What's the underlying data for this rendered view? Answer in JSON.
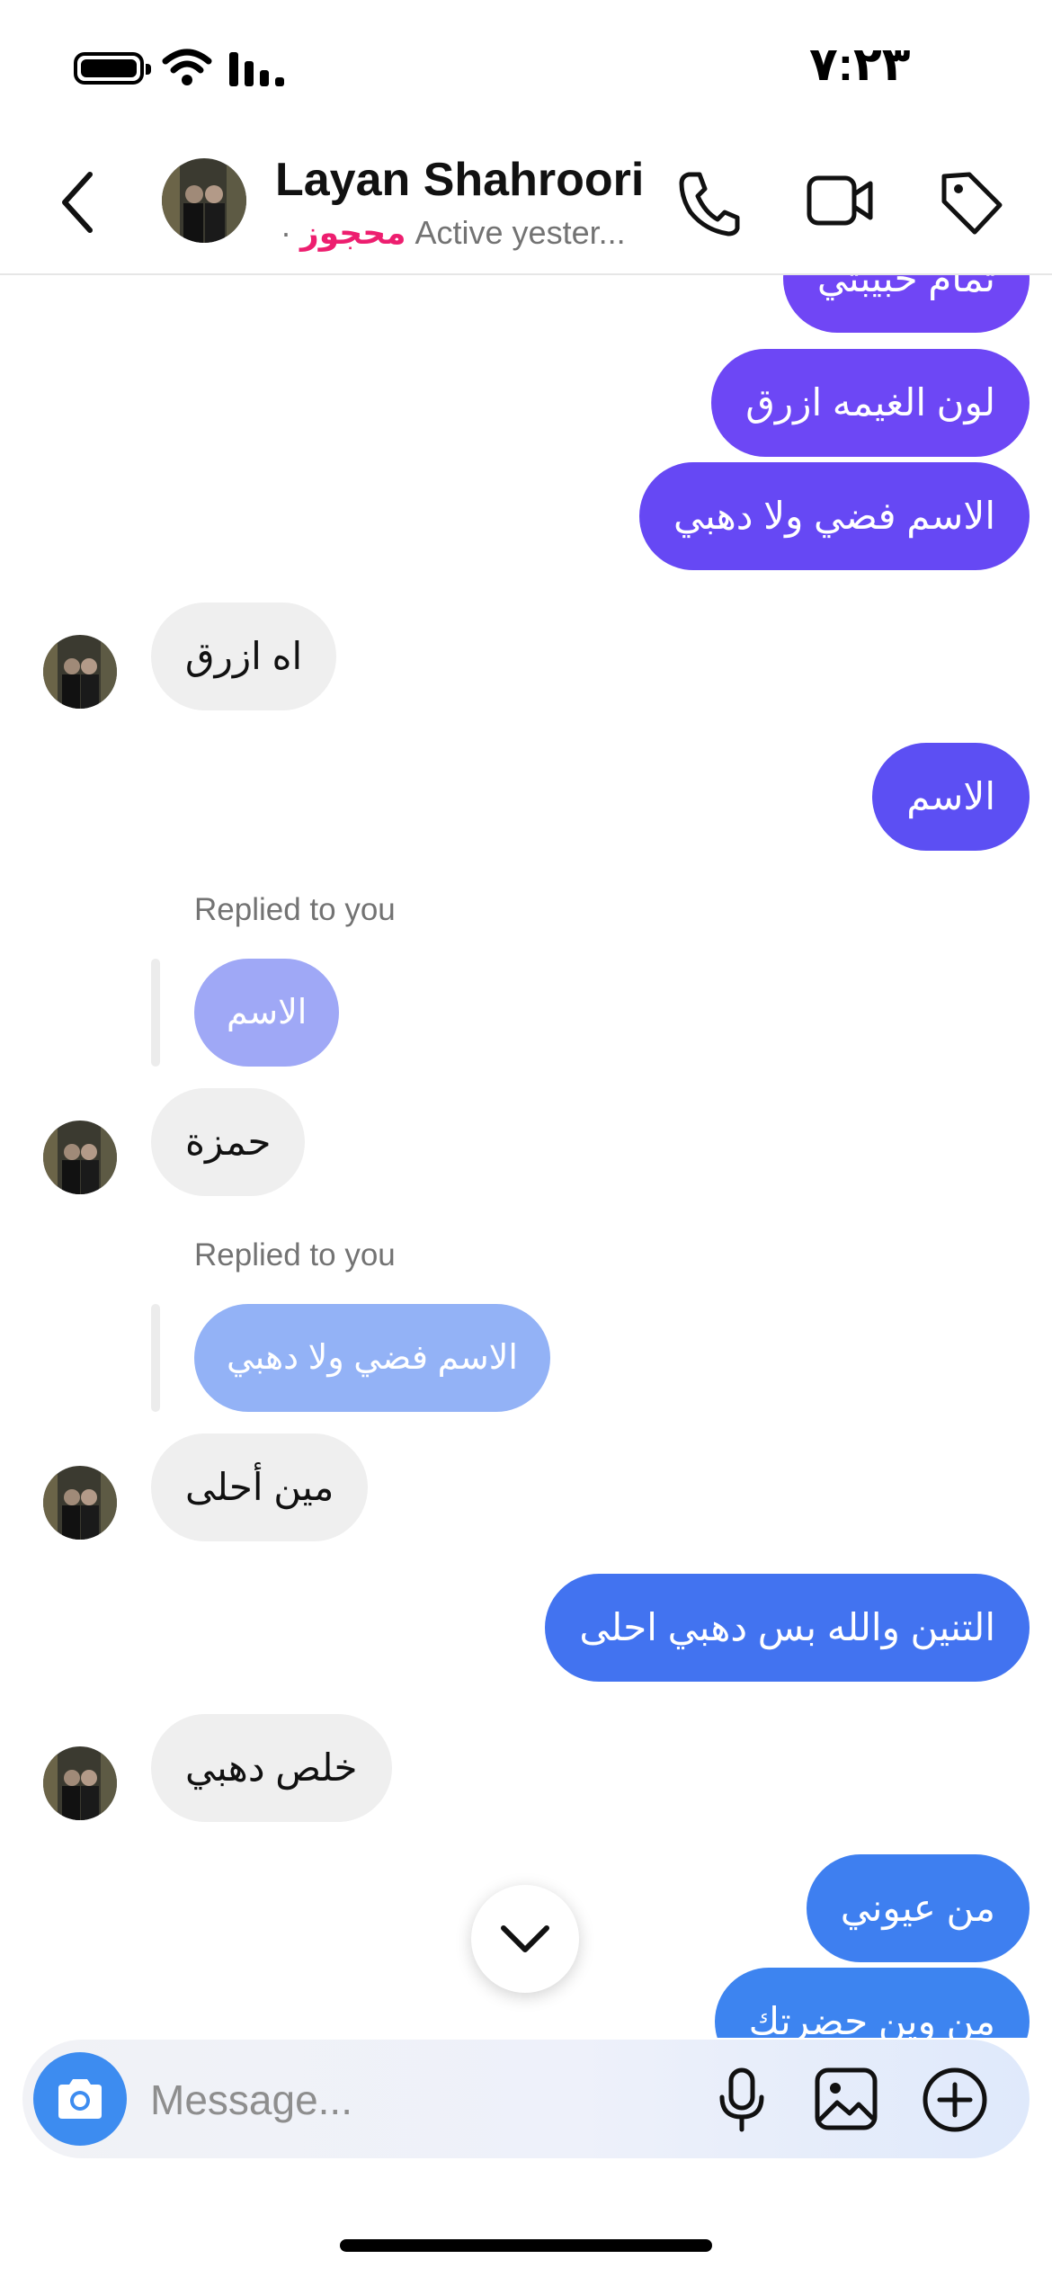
{
  "status_bar": {
    "time": "٧:٢٣"
  },
  "header": {
    "back_icon": "chevron-left-icon",
    "name": "Layan Shahroori",
    "reserved_label": "محجوز",
    "separator": "·",
    "active_status": "Active yester...",
    "actions": [
      "phone-icon",
      "video-camera-icon",
      "tag-icon"
    ]
  },
  "messages": [
    {
      "side": "out",
      "text": "تمام حبيبتي",
      "color": "#7046f5"
    },
    {
      "side": "out",
      "text": "لون الغيمه ازرق",
      "color": "#6d47f5"
    },
    {
      "side": "out",
      "text": "الاسم فضي ولا دهبي",
      "color": "#6648f4"
    },
    {
      "side": "in",
      "text": "اه ازرق"
    },
    {
      "side": "out",
      "text": "الاسم",
      "color": "#5c4ff3"
    },
    {
      "side": "in",
      "reply_label": "Replied to you",
      "quoted": "الاسم",
      "text": "حمزة"
    },
    {
      "side": "in",
      "reply_label": "Replied to you",
      "quoted": "الاسم فضي ولا دهبي",
      "text": "مين أحلى"
    },
    {
      "side": "out",
      "text": "التنين والله بس دهبي احلى",
      "color": "#4273f0"
    },
    {
      "side": "in",
      "text": "خلص دهبي"
    },
    {
      "side": "out",
      "text": "من عيوني",
      "color": "#3e7ff0"
    },
    {
      "side": "out",
      "text": "من وين حضرتك",
      "color": "#3d84f0"
    }
  ],
  "composer": {
    "placeholder": "Message...",
    "icons": [
      "camera-icon",
      "microphone-icon",
      "gallery-icon",
      "plus-circle-icon"
    ]
  }
}
